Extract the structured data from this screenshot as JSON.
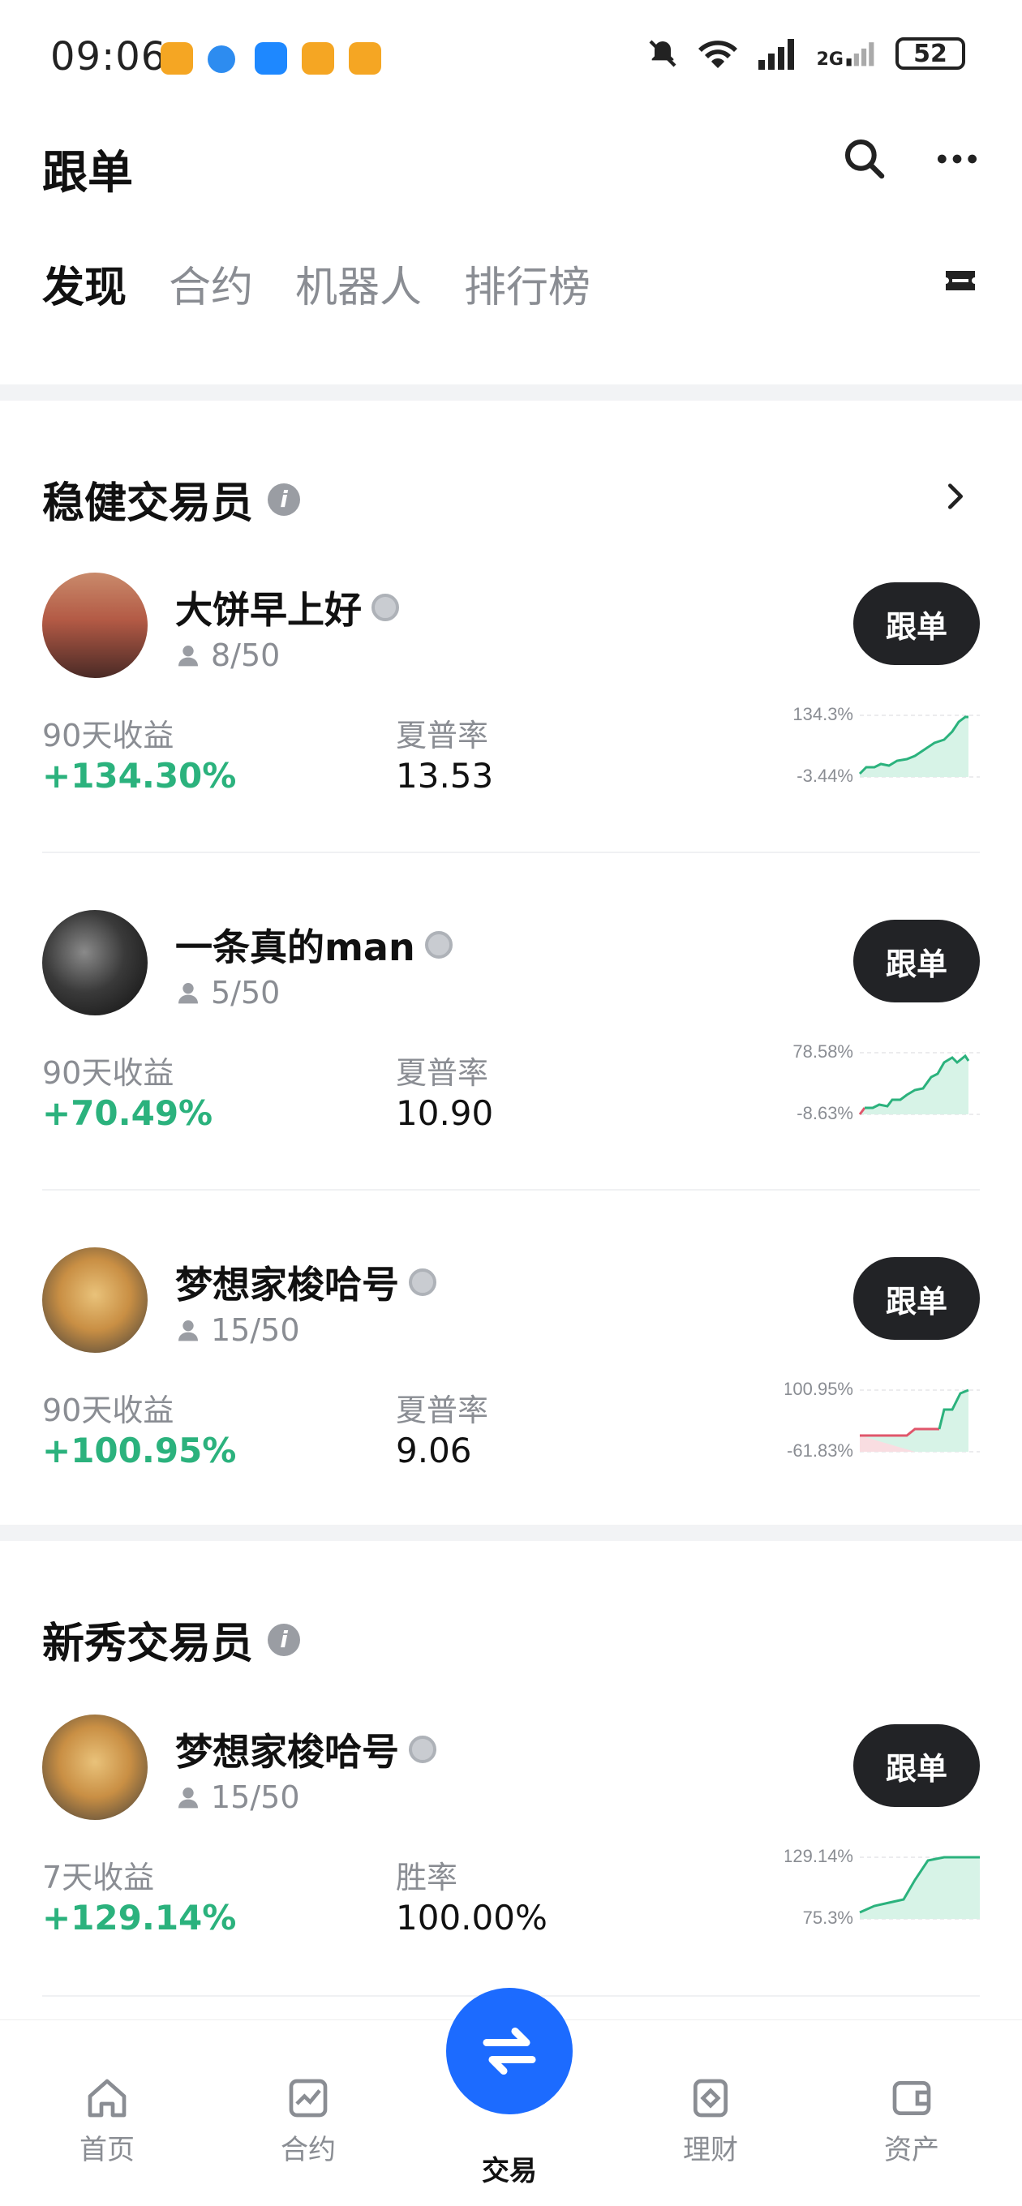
{
  "status_bar": {
    "time": "09:06",
    "battery": "52",
    "network": "2G"
  },
  "header": {
    "title": "跟单"
  },
  "tabs": [
    "发现",
    "合约",
    "机器人",
    "排行榜"
  ],
  "sections": {
    "steady": {
      "title": "稳健交易员",
      "traders": [
        {
          "name": "大饼早上好",
          "followers": "8/50",
          "metric1_label": "90天收益",
          "metric1_value": "+134.30%",
          "metric2_label": "夏普率",
          "metric2_value": "13.53",
          "chart_max": "134.3%",
          "chart_min": "-3.44%",
          "follow": "跟单"
        },
        {
          "name": "一条真的man",
          "followers": "5/50",
          "metric1_label": "90天收益",
          "metric1_value": "+70.49%",
          "metric2_label": "夏普率",
          "metric2_value": "10.90",
          "chart_max": "78.58%",
          "chart_min": "-8.63%",
          "follow": "跟单"
        },
        {
          "name": "梦想家梭哈号",
          "followers": "15/50",
          "metric1_label": "90天收益",
          "metric1_value": "+100.95%",
          "metric2_label": "夏普率",
          "metric2_value": "9.06",
          "chart_max": "100.95%",
          "chart_min": "-61.83%",
          "follow": "跟单"
        }
      ]
    },
    "rookie": {
      "title": "新秀交易员",
      "traders": [
        {
          "name": "梦想家梭哈号",
          "followers": "15/50",
          "metric1_label": "7天收益",
          "metric1_value": "+129.14%",
          "metric2_label": "胜率",
          "metric2_value": "100.00%",
          "chart_max": "129.14%",
          "chart_min": "75.3%",
          "follow": "跟单"
        }
      ]
    }
  },
  "bottom_nav": {
    "home": "首页",
    "contract": "合约",
    "trade": "交易",
    "finance": "理财",
    "assets": "资产"
  },
  "colors": {
    "accent": "#1c6bff",
    "positive": "#2bb27d",
    "negative": "#e0566b",
    "button_dark": "#222326"
  }
}
